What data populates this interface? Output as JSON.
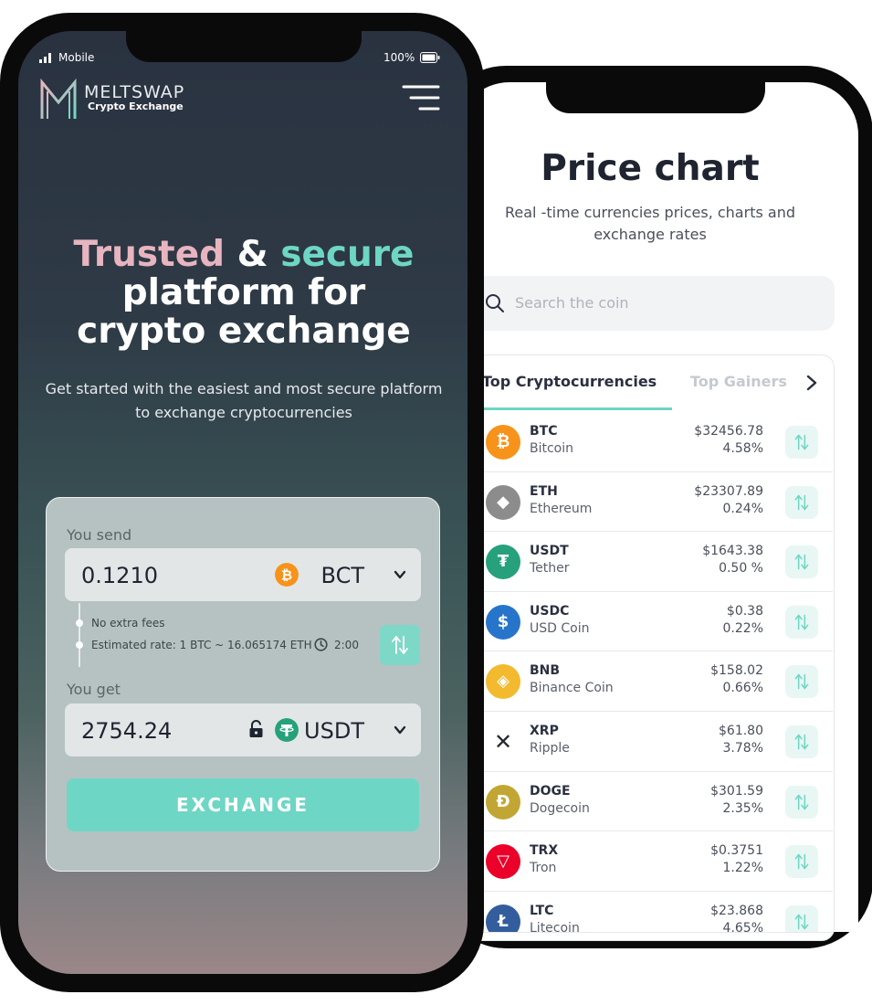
{
  "status_bar": {
    "carrier": "Mobile",
    "battery": "100%"
  },
  "brand": {
    "name": "MELTSWAP",
    "tagline": "Crypto Exchange"
  },
  "hero": {
    "word1": "Trusted",
    "amp": " & ",
    "word2": "secure",
    "line2": "platform for",
    "line3": "crypto exchange",
    "subtitle": "Get started with the easiest and most secure platform to exchange cryptocurrencies"
  },
  "exchange": {
    "send_label": "You send",
    "send_value": "0.1210",
    "send_currency": "BCT",
    "info_fees": "No extra fees",
    "info_rate": "Estimated rate: 1 BTC ~ 16.065174 ETH",
    "info_timer": "2:00",
    "get_label": "You get",
    "get_value": "2754.24",
    "get_currency": "USDT",
    "button": "EXCHANGE"
  },
  "price_chart": {
    "title": "Price chart",
    "subtitle": "Real -time currencies prices, charts and exchange rates",
    "search_placeholder": "Search the coin",
    "tabs": [
      "Top Cryptocurrencies",
      "Top Gainers"
    ],
    "coins": [
      {
        "symbol": "BTC",
        "name": "Bitcoin",
        "price": "$32456.78",
        "change": "4.58%",
        "color": "#f7931a"
      },
      {
        "symbol": "ETH",
        "name": "Ethereum",
        "price": "$23307.89",
        "change": "0.24%",
        "color": "#8c8c8c"
      },
      {
        "symbol": "USDT",
        "name": "Tether",
        "price": "$1643.38",
        "change": "0.50 %",
        "color": "#26a17b"
      },
      {
        "symbol": "USDC",
        "name": "USD Coin",
        "price": "$0.38",
        "change": "0.22%",
        "color": "#2775ca"
      },
      {
        "symbol": "BNB",
        "name": "Binance Coin",
        "price": "$158.02",
        "change": "0.66%",
        "color": "#f3ba2f"
      },
      {
        "symbol": "XRP",
        "name": "Ripple",
        "price": "$61.80",
        "change": "3.78%",
        "color": "#23292f"
      },
      {
        "symbol": "DOGE",
        "name": "Dogecoin",
        "price": "$301.59",
        "change": "2.35%",
        "color": "#c2a633"
      },
      {
        "symbol": "TRX",
        "name": "Tron",
        "price": "$0.3751",
        "change": "1.22%",
        "color": "#eb0029"
      },
      {
        "symbol": "LTC",
        "name": "Litecoin",
        "price": "$23.868",
        "change": "4.65%",
        "color": "#345d9d"
      }
    ]
  },
  "colors": {
    "accent_teal": "#6ed6c4",
    "accent_pink": "#e7b4bf"
  }
}
